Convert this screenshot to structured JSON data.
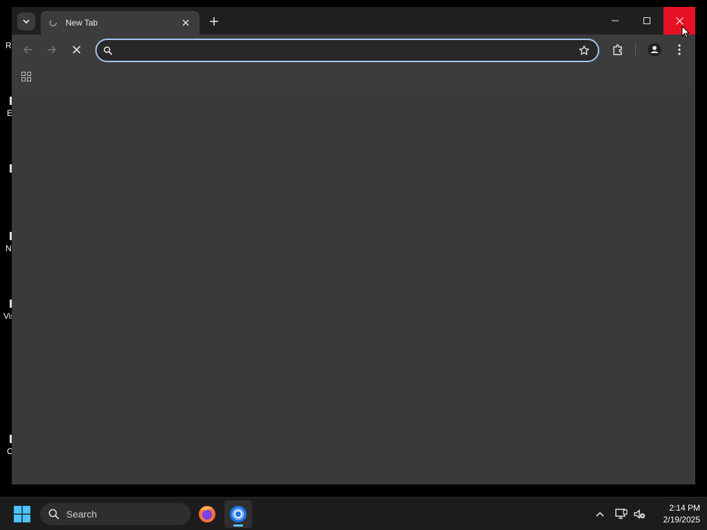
{
  "desktop": {
    "partial_labels": [
      "R",
      "E",
      "N",
      "Vis",
      "C"
    ]
  },
  "browser": {
    "tab": {
      "title": "New Tab"
    },
    "omnibox": {
      "value": "",
      "placeholder": ""
    },
    "colors": {
      "accent": "#a8c7fa",
      "close_hover": "#e81123",
      "frame": "#1f1f1f",
      "toolbar": "#3c3c3c"
    }
  },
  "taskbar": {
    "search_label": "Search",
    "clock": {
      "time": "2:14 PM",
      "date": "2/19/2025"
    },
    "apps": [
      "firefox-icon",
      "chrome-icon"
    ]
  }
}
